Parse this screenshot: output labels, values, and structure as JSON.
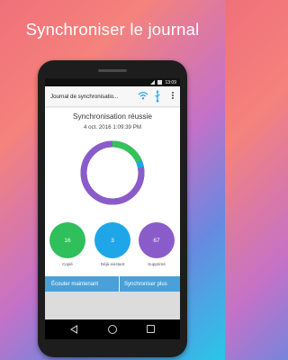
{
  "promo": {
    "title": "Synchroniser le journal"
  },
  "status_bar": {
    "time": "13:09"
  },
  "app_bar": {
    "title": "Journal de synchronisatio..."
  },
  "main": {
    "status_title": "Synchronisation réussie",
    "timestamp": "4 oct. 2016 1:09:39 PM"
  },
  "donut": {
    "ring_color": "#8a5cc9",
    "segments": [
      {
        "value": 16,
        "color": "#33c359"
      },
      {
        "value": 3,
        "color": "#1ea6e8"
      },
      {
        "value": 67,
        "color": "#8a5cc9"
      }
    ]
  },
  "stats": [
    {
      "value": "16",
      "label": "Copié",
      "color": "#2fbf5b"
    },
    {
      "value": "3",
      "label": "Déjà existant",
      "color": "#1ea6e8"
    },
    {
      "value": "67",
      "label": "Supprimé",
      "color": "#8a5cc9"
    }
  ],
  "actions": {
    "listen_now": "Écouter maintenant",
    "sync_more": "Synchroniser plus"
  },
  "colors": {
    "action_bar": "#4aa0d8"
  }
}
